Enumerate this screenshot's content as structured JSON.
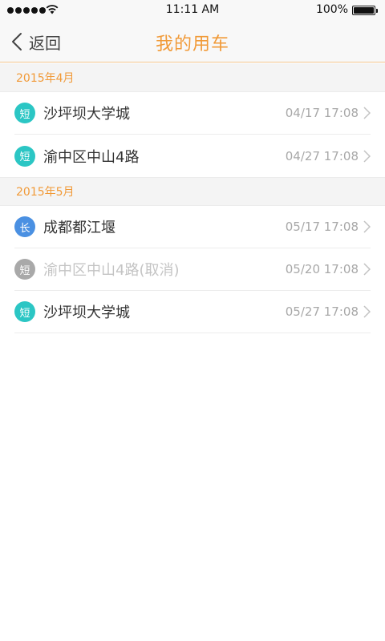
{
  "status_bar": {
    "time": "11:11 AM",
    "battery": "100%"
  },
  "nav": {
    "back_label": "返回",
    "title": "我的用车"
  },
  "sections": [
    {
      "header": "2015年4月",
      "rows": [
        {
          "badge": "短",
          "badge_type": "short",
          "place": "沙坪坝大学城",
          "time": "04/17 17:08"
        },
        {
          "badge": "短",
          "badge_type": "short",
          "place": "渝中区中山4路",
          "time": "04/27 17:08"
        }
      ]
    },
    {
      "header": "2015年5月",
      "rows": [
        {
          "badge": "长",
          "badge_type": "long",
          "place": "成都都江堰",
          "time": "05/17 17:08"
        },
        {
          "badge": "短",
          "badge_type": "cancelled",
          "place": "渝中区中山4路(取消)",
          "time": "05/20 17:08"
        },
        {
          "badge": "短",
          "badge_type": "short",
          "place": "沙坪坝大学城",
          "time": "05/27 17:08"
        }
      ]
    }
  ],
  "colors": {
    "accent": "#f19a38",
    "short_badge": "#2bc6c4",
    "long_badge": "#4a90e2",
    "cancelled_badge": "#a9a9a9"
  },
  "icons": [
    "signal-icon",
    "wifi-icon",
    "battery-icon",
    "back-chevron-icon",
    "chevron-right-icon"
  ]
}
